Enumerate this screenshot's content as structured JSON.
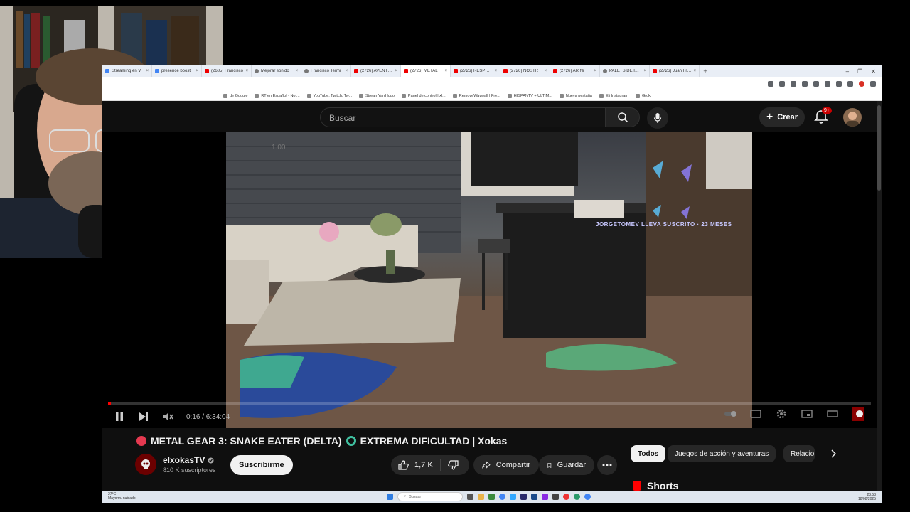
{
  "browser": {
    "tabs": [
      {
        "title": "Streaming en V",
        "fav": "google"
      },
      {
        "title": "presence boost",
        "fav": "google"
      },
      {
        "title": "(2685) Francisco",
        "fav": "youtube"
      },
      {
        "title": "Mejorar sonido",
        "fav": "other"
      },
      {
        "title": "Francisco Termi",
        "fav": "other"
      },
      {
        "title": "(2726) AVENTUR",
        "fav": "youtube"
      },
      {
        "title": "(2726) METAL",
        "fav": "youtube",
        "active": true
      },
      {
        "title": "(2726) RESPUEST",
        "fav": "youtube"
      },
      {
        "title": "(2726) NOSTR",
        "fav": "youtube"
      },
      {
        "title": "(2726) AR Ni",
        "fav": "youtube"
      },
      {
        "title": "PALETS DE IMPEC",
        "fav": "other"
      },
      {
        "title": "(2726) Juan Fran",
        "fav": "youtube"
      }
    ],
    "new_tab": "+",
    "bookmarks": [
      "de Google",
      "RT en Español - Not...",
      "YouTube, Twitch, Tw...",
      "StreamYard logo",
      "Panel de control | xl...",
      "RemoveWaywall | Fre...",
      "HISPANTV + ULTIM...",
      "Nueva pestaña",
      "Eli Instagram",
      "Grok"
    ]
  },
  "youtube": {
    "search_placeholder": "Buscar",
    "create_label": "Crear",
    "notif_badge": "9+",
    "player": {
      "speed_badge": "1.00",
      "overlay_text": "JORGETOMEV LLEVA SUSCRITO · 23 MESES",
      "time": "0:16 / 6:34:04",
      "progress": 0.001
    },
    "video": {
      "title": "METAL GEAR 3: SNAKE EATER (DELTA)",
      "title_suffix": "EXTREMA DIFICULTAD | Xokas",
      "channel": "elxokasTV",
      "subscribers": "810 K suscriptores",
      "subscribe_label": "Suscribirme",
      "likes": "1,7 K",
      "share_label": "Compartir",
      "save_label": "Guardar"
    },
    "chips": [
      "Todos",
      "Juegos de acción y aventuras",
      "Relacio"
    ],
    "shorts_label": "Shorts"
  },
  "taskbar": {
    "weather": [
      "27°C",
      "Mayorm. nublado"
    ],
    "search_placeholder": "Buscar",
    "clock": [
      "23:53",
      "18/08/2025"
    ]
  }
}
